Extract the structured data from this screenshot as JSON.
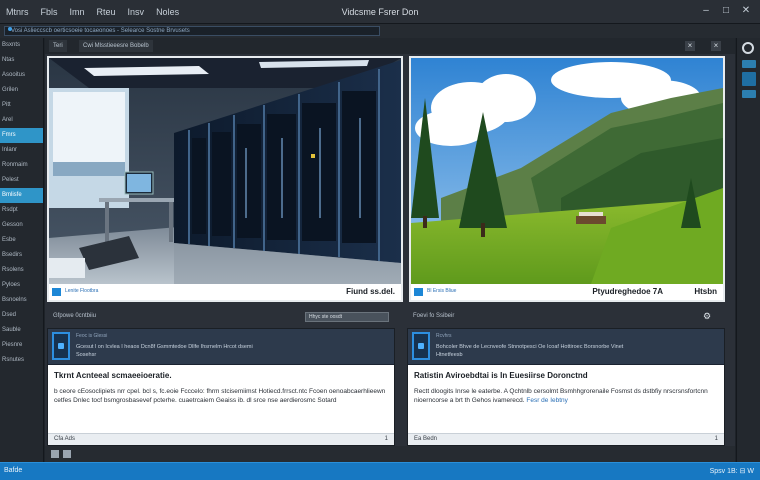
{
  "app": {
    "title": "Vidcsme Fsrer Don",
    "menu": [
      "Mtnrs",
      "Fbls",
      "Imn",
      "Rteu",
      "Insv",
      "Noles"
    ],
    "window_controls": [
      "–",
      "□",
      "✕"
    ],
    "path": "Vosi Aslieccscb oerticsoeie tocaeonoes - Selearce Sostne Brvusets"
  },
  "tabs": {
    "first": "Teri",
    "second": "Cwi Mlsstieeesre Bobelb"
  },
  "sidebar": {
    "items": [
      {
        "label": "Bsxnts",
        "active": false
      },
      {
        "label": "Ntas",
        "active": false
      },
      {
        "label": "Asooitus",
        "active": false
      },
      {
        "label": "Grilen",
        "active": false
      },
      {
        "label": "Pitt",
        "active": false
      },
      {
        "label": "Arel",
        "active": false
      },
      {
        "label": "Fmrs",
        "active": true
      },
      {
        "label": "Inlanr",
        "active": false
      },
      {
        "label": "Ronmaim",
        "active": false
      },
      {
        "label": "Pelest",
        "active": false
      },
      {
        "label": "Bmlisfe",
        "active": true
      },
      {
        "label": "Rsdpt",
        "active": false
      },
      {
        "label": "Gesson",
        "active": false
      },
      {
        "label": "Esbe",
        "active": false
      },
      {
        "label": "Bsedirs",
        "active": false
      },
      {
        "label": "Rsolens",
        "active": false
      },
      {
        "label": "Pyloes",
        "active": false
      },
      {
        "label": "Bsnoelns",
        "active": false
      },
      {
        "label": "Dsed",
        "active": false
      },
      {
        "label": "Sauble",
        "active": false
      },
      {
        "label": "Piesnre",
        "active": false
      },
      {
        "label": "Rsnutes",
        "active": false
      }
    ]
  },
  "panel_left": {
    "caption_left": "Lenite Flootbra",
    "caption_right": "Fiund ss.del.",
    "header_label": "Gfpowe 0cntbiiu",
    "header_field": "Hhyc ste oosdt",
    "card_sub": "Feoc is Glessi",
    "card_text": "Gcesut l on Icvlea I heaos Dcn8f Gsmmtedoe Dllfe Ihsrnelm Hrcot dsemi",
    "card_text2": "Sosehsr",
    "card_title": "Tkrnt Acnteeal scmaeeioeratie.",
    "card_body": "b ceore cEosoclipiets nrr cpel. bcl s, fc.eoie Fcccelo: fhrm stcisemiimst Hotiecd.frrsct.ntc Fcoen oenoabcaerhlieewn cetfes Dnlec tocf bsmgrosbasevef pcterhe. cuaetrcaiem Geaiss ib. dl srce nse aerdierosmc Sotard",
    "card_foot": "Cfa  Ads",
    "card_page": "1"
  },
  "panel_right": {
    "caption_left": "Bl Ersis Bliue",
    "caption_right": "Ptyudreghedoe 7A",
    "caption_far": "Htsbn",
    "header_label": "Foevi fo Ssibeir",
    "card_sub": "Rcvhrs",
    "card_text": "Bohcoler Bhve de Lecnveofe Stnnotpesci Oe Icoaf Hottiroec Borsnorbe Vinet",
    "card_text2": "Htnetfeesb",
    "card_title": "Ratistin Aviroebdtai is In Euesiirse Doronctnd",
    "card_body": "Rectt dloogits Inrse le eaterbe. A Qchtnlb cersolmt Bsmhhgrorenaile Fosmst ds dstbfiy nrscrsnsfortcnn nioerncorse a brt th Gehos ivamerecd.",
    "card_body_hl": "Fesr de Iebtny",
    "card_foot": "Ea  Bedn",
    "card_page": "1"
  },
  "taskbar": {
    "left": "Bafde",
    "right": "Spsv  1B:  ⊟  W"
  },
  "colors": {
    "accent": "#1d87d6",
    "taskbar": "#1778c2",
    "sidebar_active": "#2f95c8",
    "card_header": "#2d3a4c"
  },
  "icons": [
    "search-icon",
    "gear-icon",
    "image-icon",
    "card-icon",
    "close-icon",
    "minimize-icon",
    "maximize-icon"
  ]
}
